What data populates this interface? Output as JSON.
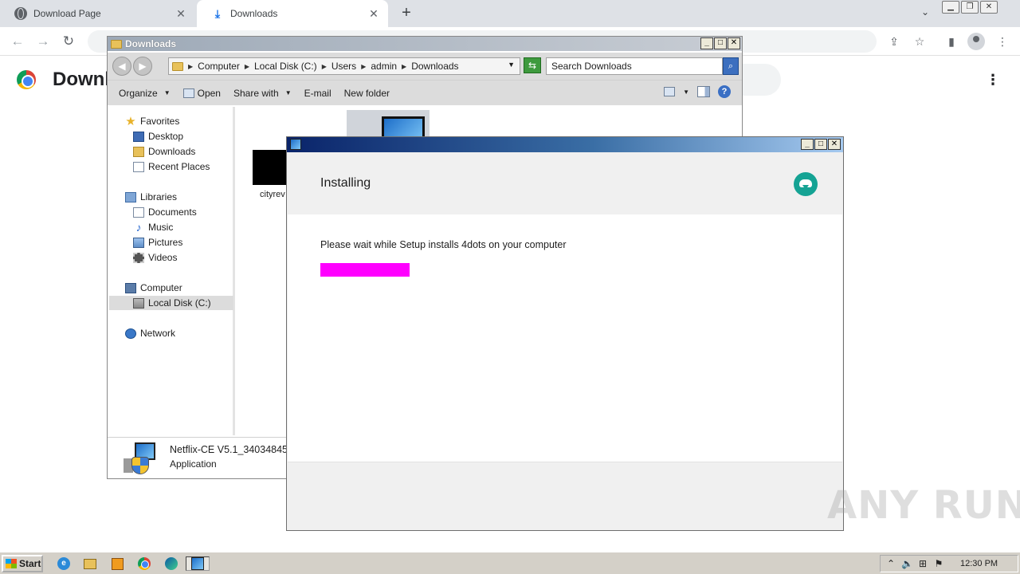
{
  "browser": {
    "tabs": [
      {
        "title": "Download Page",
        "icon": "globe-icon"
      },
      {
        "title": "Downloads",
        "icon": "download-icon"
      }
    ],
    "page_heading": "Downlo"
  },
  "explorer": {
    "title": "Downloads",
    "breadcrumb": [
      "Computer",
      "Local Disk (C:)",
      "Users",
      "admin",
      "Downloads"
    ],
    "search_placeholder": "Search Downloads",
    "commands": {
      "organize": "Organize",
      "open": "Open",
      "share_with": "Share with",
      "email": "E-mail",
      "new_folder": "New folder"
    },
    "nav": {
      "favorites": "Favorites",
      "desktop": "Desktop",
      "downloads": "Downloads",
      "recent": "Recent Places",
      "libraries": "Libraries",
      "documents": "Documents",
      "music": "Music",
      "pictures": "Pictures",
      "videos": "Videos",
      "computer": "Computer",
      "local_disk": "Local Disk (C:)",
      "network": "Network"
    },
    "files": [
      {
        "label": "cityrev"
      }
    ],
    "details": {
      "name": "Netflix-CE V5.1_34034845",
      "type": "Application"
    }
  },
  "installer": {
    "heading": "Installing",
    "message": "Please wait while Setup installs 4dots on your computer",
    "progress_percent": 20,
    "progress_color": "#ff00ff",
    "accent_color": "#15a394"
  },
  "taskbar": {
    "start_label": "Start",
    "clock": "12:30 PM"
  },
  "watermark": "ANY RUN"
}
